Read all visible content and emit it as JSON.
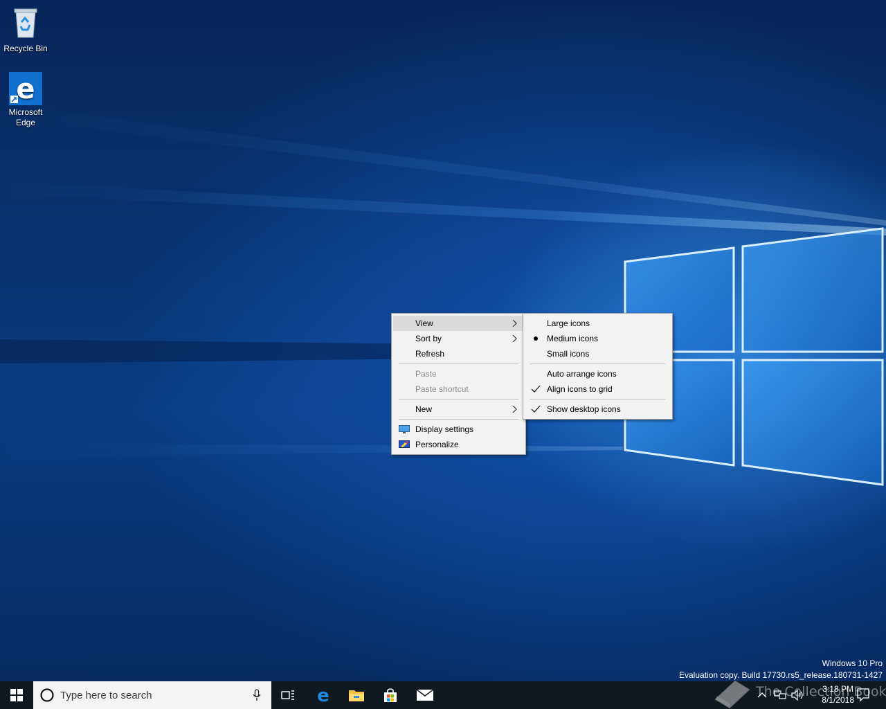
{
  "desktop": {
    "icons": [
      {
        "label": "Recycle Bin",
        "icon": "recycle-bin-icon"
      },
      {
        "label": "Microsoft Edge",
        "icon": "edge-icon"
      }
    ]
  },
  "context_menu": {
    "items": {
      "view": "View",
      "sort_by": "Sort by",
      "refresh": "Refresh",
      "paste": "Paste",
      "paste_shortcut": "Paste shortcut",
      "new": "New",
      "display_settings": "Display settings",
      "personalize": "Personalize"
    }
  },
  "view_submenu": {
    "large_icons": "Large icons",
    "medium_icons": "Medium icons",
    "small_icons": "Small icons",
    "auto_arrange": "Auto arrange icons",
    "align_to_grid": "Align icons to grid",
    "show_desktop_icons": "Show desktop icons",
    "selected_size": "Medium icons",
    "checked": [
      "Align icons to grid",
      "Show desktop icons"
    ]
  },
  "watermark": {
    "edition": "Windows 10 Pro",
    "build": "Evaluation copy. Build 17730.rs5_release.180731-1427"
  },
  "taskbar": {
    "search_placeholder": "Type here to search",
    "pinned": [
      "task-view-icon",
      "edge-icon",
      "file-explorer-icon",
      "store-icon",
      "mail-icon"
    ],
    "clock_time": "3:18 PM",
    "clock_date": "8/1/2018",
    "overlay_text": "The Collection Book"
  },
  "colors": {
    "taskbar": "#101820",
    "menu_bg": "#f2f2f2",
    "menu_hover": "#dadada",
    "accent": "#0078d7"
  }
}
